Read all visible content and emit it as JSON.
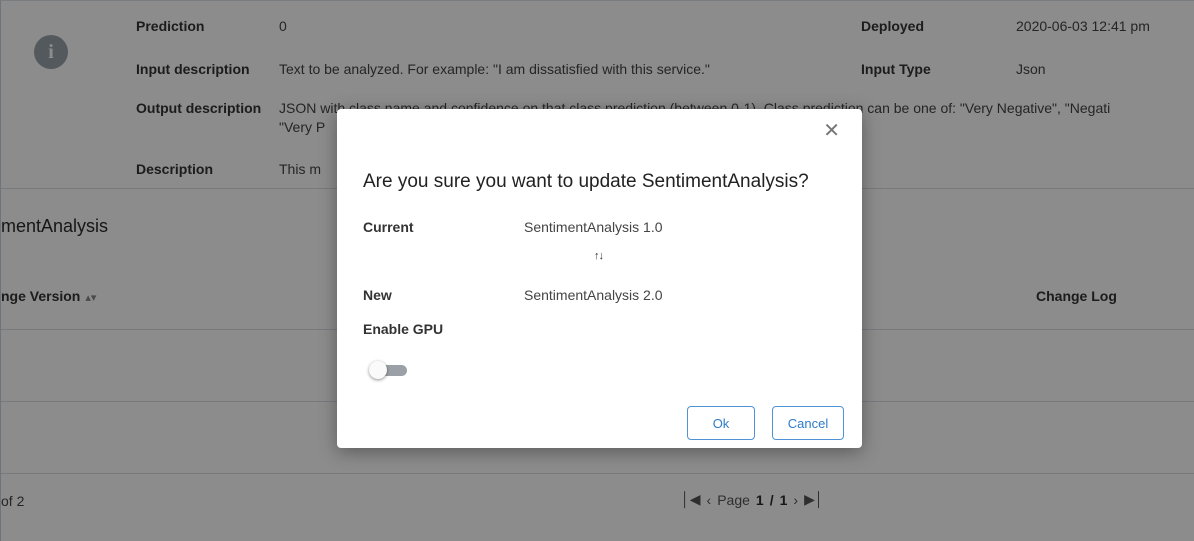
{
  "details": {
    "prediction_label": "Prediction",
    "prediction_value": "0",
    "input_description_label": "Input description",
    "input_description_value": "Text to be analyzed. For example: \"I am dissatisfied with this service.\"",
    "output_description_label": "Output description",
    "output_description_value_line1": "JSON with class name and confidence on that class prediction (between 0-1). Class prediction can be one of: \"Very Negative\", \"Negati",
    "output_description_value_line2": "\"Very P",
    "description_label": "Description",
    "description_value": "This m",
    "deployed_label": "Deployed",
    "deployed_value": "2020-06-03 12:41 pm",
    "input_type_label": "Input Type",
    "input_type_value": "Json"
  },
  "section": {
    "title": "mentAnalysis",
    "col_version": "nge Version",
    "col_version_sort_icon": "sort-icon",
    "col_changelog": "Change Log"
  },
  "pagination": {
    "records": "of 2",
    "prefix": "Page",
    "current": "1",
    "separator": "/",
    "total": "1"
  },
  "modal": {
    "title": "Are you sure you want to update SentimentAnalysis?",
    "current_label": "Current",
    "current_value": "SentimentAnalysis 1.0",
    "new_label": "New",
    "new_value": "SentimentAnalysis 2.0",
    "gpu_label": "Enable GPU",
    "gpu_enabled": false,
    "ok_label": "Ok",
    "cancel_label": "Cancel"
  },
  "colors": {
    "accent": "#2f7bc8",
    "overlay": "rgba(0,0,0,0.45)"
  }
}
